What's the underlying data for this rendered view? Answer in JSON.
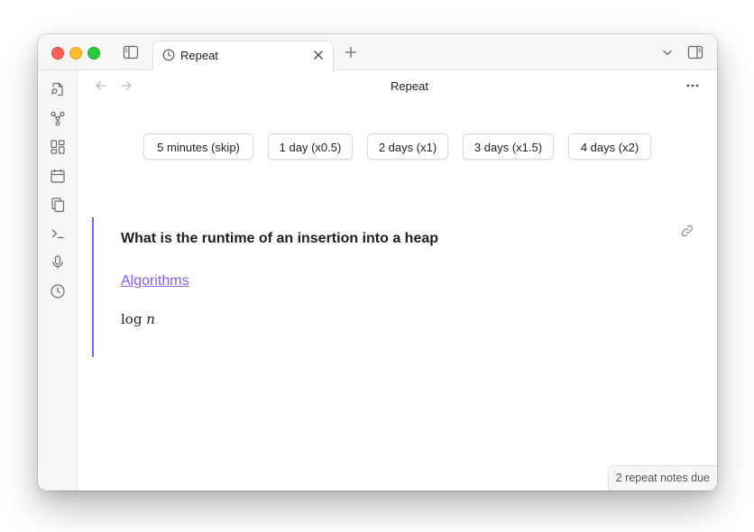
{
  "tab": {
    "title": "Repeat",
    "icon": "clock-icon"
  },
  "view": {
    "title": "Repeat"
  },
  "ribbon": {
    "items": [
      "open-quick-switcher-icon",
      "graph-view-icon",
      "canvas-icon",
      "daily-note-icon",
      "templates-icon",
      "command-palette-icon",
      "audio-recorder-icon",
      "repeat-icon"
    ]
  },
  "schedule_buttons": [
    "5 minutes (skip)",
    "1 day (x0.5)",
    "2 days (x1)",
    "3 days (x1.5)",
    "4 days (x2)"
  ],
  "note": {
    "question": "What is the runtime of an insertion into a heap",
    "tag_link": "Algorithms",
    "answer_fn": "log",
    "answer_var": "n"
  },
  "status_bar": {
    "text": "2 repeat notes due"
  },
  "colors": {
    "accent": "#8a5cf5",
    "chrome": "#f6f6f6",
    "background": "#ffffff"
  }
}
